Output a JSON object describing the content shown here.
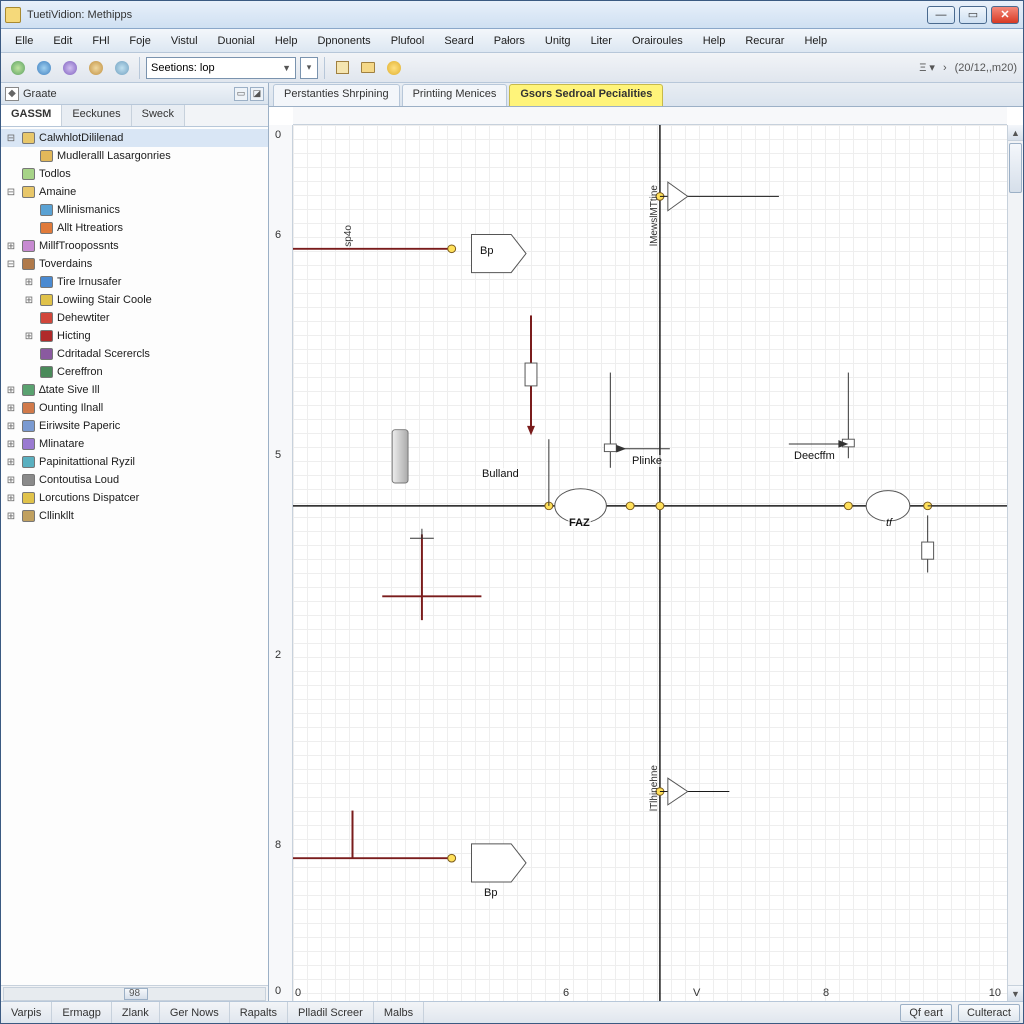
{
  "window": {
    "title": "TuetiVidion: Methipps"
  },
  "menus": [
    "Elle",
    "Edit",
    "FHl",
    "Foje",
    "Vistul",
    "Duonial",
    "Help",
    "Dpnonents",
    "Plufool",
    "Seard",
    "Pałors",
    "Unitg",
    "Liter",
    "Orairoules",
    "Help",
    "Recurar",
    "Help"
  ],
  "toolbar": {
    "combo_label": "Seetions: lop",
    "right_status": "(20/12,,m20)"
  },
  "side": {
    "header": "Graate",
    "tabs": [
      "GASSM",
      "Eeckunes",
      "Sweck"
    ],
    "active_tab": 0,
    "scroll_value": "98"
  },
  "tree": [
    {
      "d": 0,
      "tw": "⊟",
      "ic": "#e8c76a",
      "lbl": "CalwhlotDililenad",
      "sel": true
    },
    {
      "d": 1,
      "tw": "",
      "ic": "#e2b85a",
      "lbl": "Mudleralll Lasargonries"
    },
    {
      "d": 0,
      "tw": "",
      "ic": "#a7d488",
      "lbl": "Todlos"
    },
    {
      "d": 0,
      "tw": "⊟",
      "ic": "#e8c76a",
      "lbl": "Amaine"
    },
    {
      "d": 1,
      "tw": "",
      "ic": "#5aa2d4",
      "lbl": "Mlinismanics"
    },
    {
      "d": 1,
      "tw": "",
      "ic": "#e07a3a",
      "lbl": "Allt Htreatiors"
    },
    {
      "d": 0,
      "tw": "⊞",
      "ic": "#c78ad1",
      "lbl": "MillfTroopossnts"
    },
    {
      "d": 0,
      "tw": "⊟",
      "ic": "#b07a4a",
      "lbl": "Toverdains"
    },
    {
      "d": 1,
      "tw": "⊞",
      "ic": "#4a8ad1",
      "lbl": "Tire lrnusafer"
    },
    {
      "d": 1,
      "tw": "⊞",
      "ic": "#e0c24a",
      "lbl": "Lowiing Stair Coole"
    },
    {
      "d": 1,
      "tw": "",
      "ic": "#d1463a",
      "lbl": "Dehewtiter"
    },
    {
      "d": 1,
      "tw": "⊞",
      "ic": "#b02a2a",
      "lbl": "Hicting"
    },
    {
      "d": 1,
      "tw": "",
      "ic": "#8a5aa0",
      "lbl": "Cdritadal Scerercls"
    },
    {
      "d": 1,
      "tw": "",
      "ic": "#4a8a5a",
      "lbl": "Cereffron"
    },
    {
      "d": 0,
      "tw": "⊞",
      "ic": "#5aa270",
      "lbl": "∆tate Sive Ill"
    },
    {
      "d": 0,
      "tw": "⊞",
      "ic": "#d17a4a",
      "lbl": "Ounting Ilnall"
    },
    {
      "d": 0,
      "tw": "⊞",
      "ic": "#7a9ad1",
      "lbl": "Eiriwsite Paperic"
    },
    {
      "d": 0,
      "tw": "⊞",
      "ic": "#9a7ad1",
      "lbl": "Mlinatare"
    },
    {
      "d": 0,
      "tw": "⊞",
      "ic": "#5ab0c0",
      "lbl": "Papinitattional Ryzil"
    },
    {
      "d": 0,
      "tw": "⊞",
      "ic": "#8a8a8a",
      "lbl": "Contoutisa Loud"
    },
    {
      "d": 0,
      "tw": "⊞",
      "ic": "#e0c24a",
      "lbl": "Lorcutions Dispatcer"
    },
    {
      "d": 0,
      "tw": "⊞",
      "ic": "#c0a060",
      "lbl": "Cllinkllt"
    }
  ],
  "doctabs": {
    "items": [
      "Perstanties Shrpining",
      "Printiing Menices",
      "Gsors Sedroal Pecialities"
    ],
    "active": 2
  },
  "axes": {
    "x_ticks": [
      "0",
      "6",
      "V",
      "8",
      "10"
    ],
    "y_ticks": [
      "0",
      "8",
      "2",
      "5",
      "6",
      "0"
    ]
  },
  "nodes": {
    "bulland": "Bulland",
    "pinke": "Plinke",
    "decffm": "Deecffm",
    "faz": "FA͏Z",
    "tf": "tf",
    "bp_top": "Bp",
    "bp_bot": "Bp",
    "sp4o": "sp4o",
    "mewsmtn": "lMewslMTtine",
    "thineine": "lTlhinehne"
  },
  "status": {
    "left": [
      "Varpis",
      "Ermagp",
      "Zlank",
      "Ger Nows"
    ],
    "mid": [
      "Rapalts",
      "Plladil Screer",
      "Malbs"
    ],
    "right_btn1": "Qf eart",
    "right_btn2": "Culteract"
  }
}
